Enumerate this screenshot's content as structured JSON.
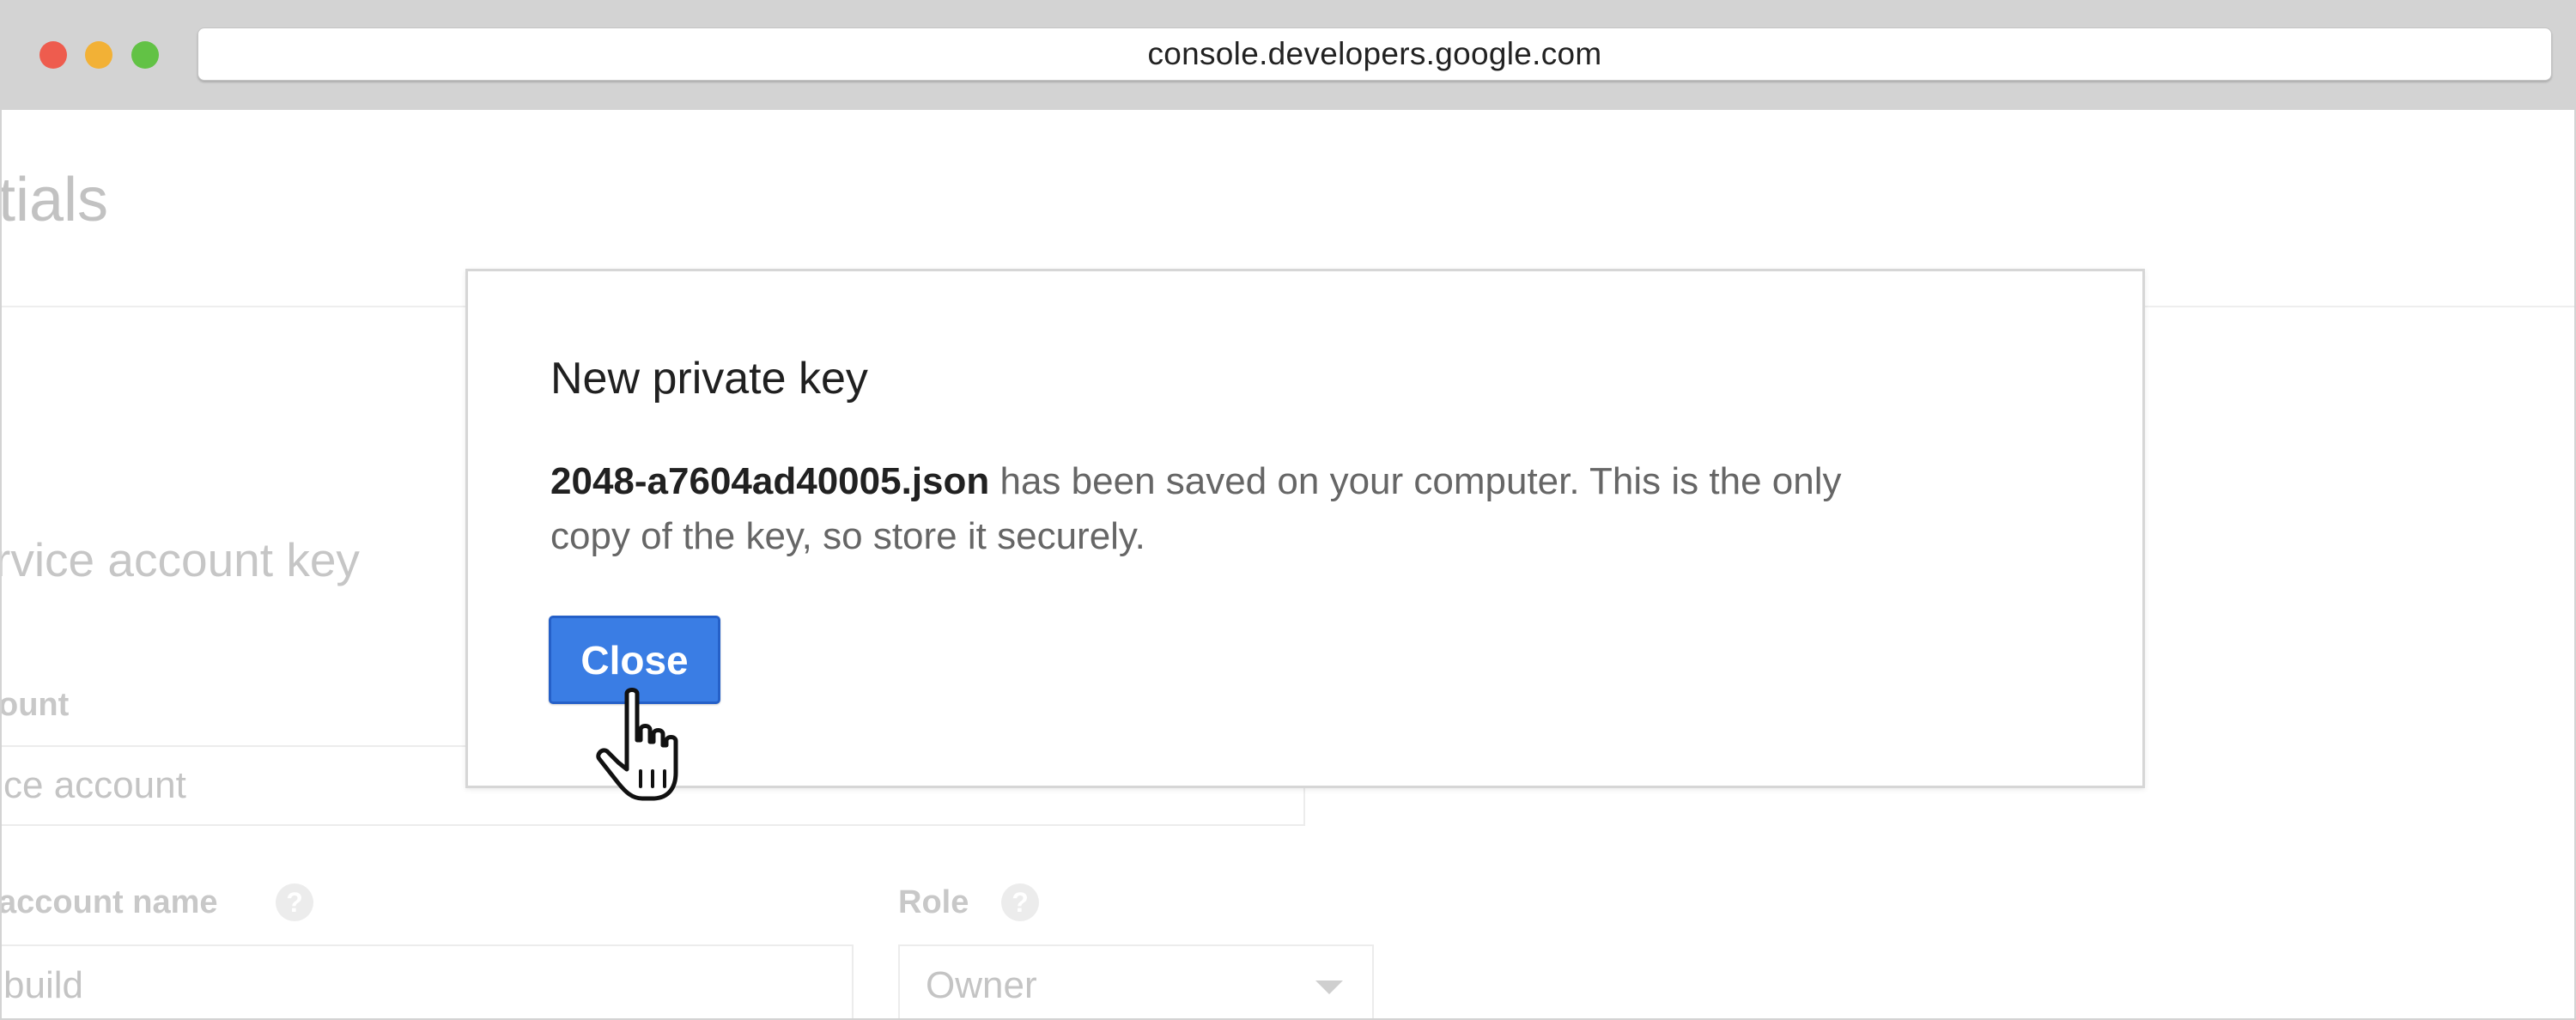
{
  "browser": {
    "url": "console.developers.google.com"
  },
  "background_page": {
    "title": "tials",
    "section_title": "rvice account key",
    "service_account_label": "ount",
    "service_account_value": "ce account",
    "account_name_label": "account name",
    "account_name_value": "build",
    "role_label": "Role",
    "role_value": "Owner",
    "help_icon_glyph": "?"
  },
  "dialog": {
    "title": "New private key",
    "filename": "2048-a7604ad40005.json",
    "message_line1": " has been saved on your computer. This is the only",
    "message_line2": "copy of the key, so store it securely.",
    "close_label": "Close"
  },
  "colors": {
    "primary_button": "#3a7de4",
    "chrome": "#d3d3d3"
  }
}
